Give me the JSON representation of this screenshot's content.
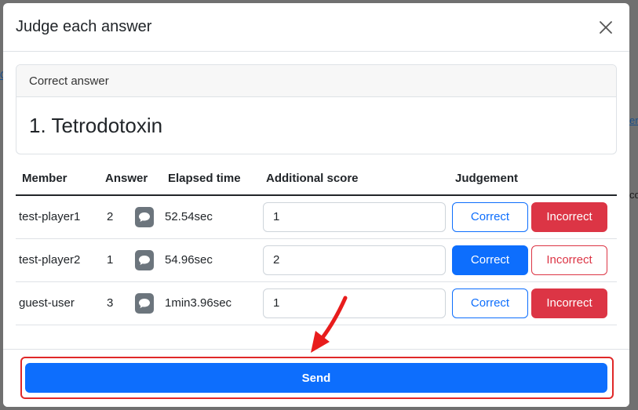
{
  "modal": {
    "title": "Judge each answer"
  },
  "correct_answer": {
    "header": "Correct answer",
    "text": "1. Tetrodotoxin"
  },
  "table": {
    "headers": [
      "Member",
      "Answer",
      "Elapsed time",
      "Additional score",
      "Judgement"
    ],
    "rows": [
      {
        "member": "test-player1",
        "answer": "2",
        "elapsed": "52.54sec",
        "score": "1",
        "judgement": "incorrect"
      },
      {
        "member": "test-player2",
        "answer": "1",
        "elapsed": "54.96sec",
        "score": "2",
        "judgement": "correct"
      },
      {
        "member": "guest-user",
        "answer": "3",
        "elapsed": "1min3.96sec",
        "score": "1",
        "judgement": "incorrect"
      }
    ],
    "correct_label": "Correct",
    "incorrect_label": "Incorrect"
  },
  "footer": {
    "send_label": "Send"
  },
  "icons": {
    "close": "close-icon",
    "chat": "chat-bubble-icon",
    "arrow": "annotation-arrow"
  },
  "colors": {
    "primary": "#0d6efd",
    "danger": "#dc3545",
    "chat_button": "#6c757d",
    "highlight": "#e02828"
  },
  "background": {
    "fragments": [
      "Q",
      "er",
      "co"
    ]
  }
}
